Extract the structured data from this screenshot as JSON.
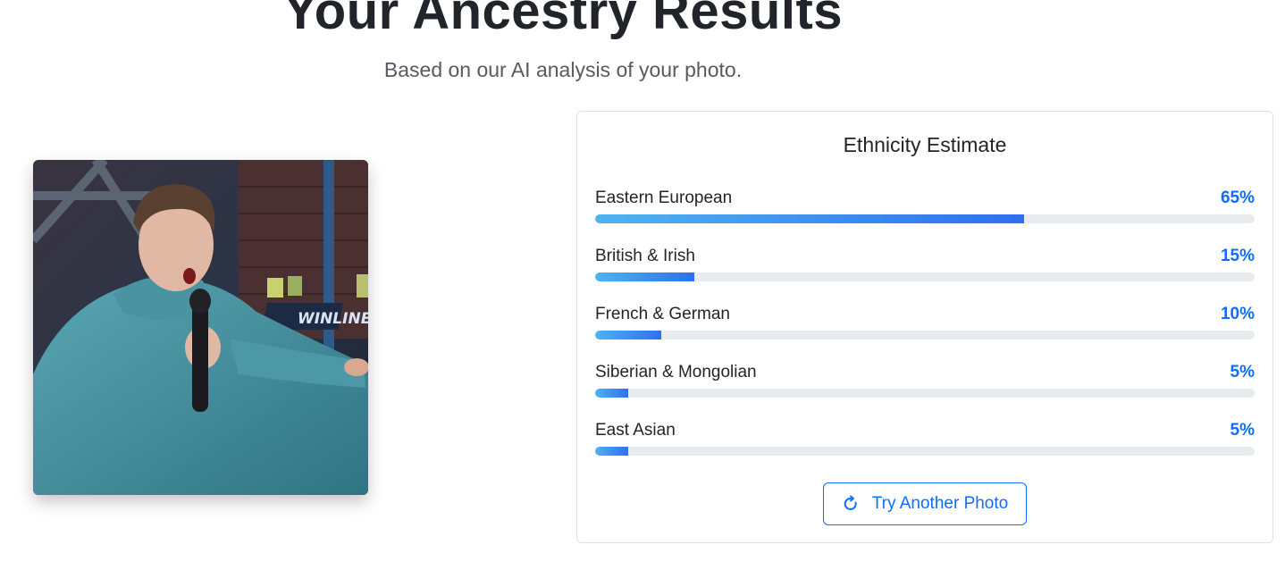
{
  "header": {
    "title": "Your Ancestry Results",
    "subtitle": "Based on our AI analysis of your photo."
  },
  "photo": {
    "sign_text": "WINLINE"
  },
  "estimate": {
    "title": "Ethnicity Estimate",
    "items": [
      {
        "label": "Eastern European",
        "percent_label": "65%",
        "percent": 65
      },
      {
        "label": "British & Irish",
        "percent_label": "15%",
        "percent": 15
      },
      {
        "label": "French & German",
        "percent_label": "10%",
        "percent": 10
      },
      {
        "label": "Siberian & Mongolian",
        "percent_label": "5%",
        "percent": 5
      },
      {
        "label": "East Asian",
        "percent_label": "5%",
        "percent": 5
      }
    ],
    "retry_button": {
      "label": "Try Another Photo",
      "icon": "refresh-icon"
    }
  },
  "colors": {
    "accent": "#0d6efd",
    "bar_gradient_start": "#4fb3f0",
    "bar_gradient_end": "#2f6ff0",
    "track": "#e9ecef"
  }
}
